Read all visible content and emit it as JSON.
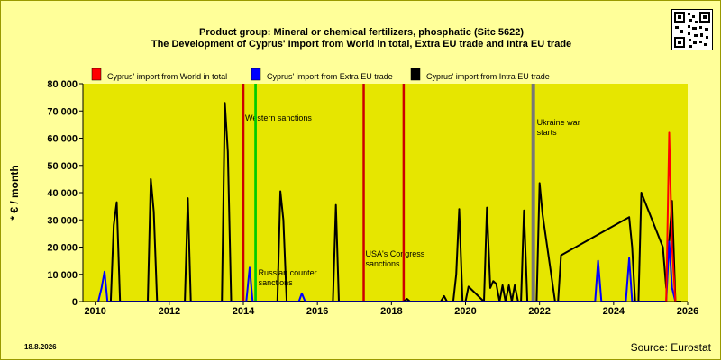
{
  "title_line1": "Product group: Mineral or chemical fertilizers, phosphatic (Sitc 5622)",
  "title_line2": "The Development of Cyprus' Import from World in total, Extra EU trade and Intra EU trade",
  "date_printed": "18.8.2026",
  "source": "Source: Eurostat",
  "icons": {
    "qr": "qr-code-icon"
  },
  "colors": {
    "background": "#ffff99",
    "plot_background": "#e6e600",
    "world": "#ff0000",
    "extra_eu": "#0000ff",
    "intra_eu": "#000000",
    "western_sanctions_line": "#00cc00",
    "event_line": "#cc0000",
    "ukraine_line": "#777777"
  },
  "chart_data": {
    "type": "line",
    "title": "Product group: Mineral or chemical fertilizers, phosphatic (Sitc 5622)",
    "subtitle": "The Development of Cyprus' Import from World in total, Extra EU trade and Intra EU trade",
    "xlabel": "",
    "ylabel": "* € / month",
    "xlim": [
      2009.667,
      2026.0
    ],
    "ylim": [
      0,
      80000
    ],
    "x_ticks": [
      2010,
      2012,
      2014,
      2016,
      2018,
      2020,
      2022,
      2024,
      2026
    ],
    "x_tick_labels": [
      "2010",
      "2012",
      "2014",
      "2016",
      "2018",
      "2020",
      "2022",
      "2024",
      "2026"
    ],
    "y_ticks": [
      0,
      10000,
      20000,
      30000,
      40000,
      50000,
      60000,
      70000,
      80000
    ],
    "y_tick_labels": [
      "0",
      "10 000",
      "20 000",
      "30 000",
      "40 000",
      "50 000",
      "60 000",
      "70 000",
      "80 000"
    ],
    "grid": false,
    "legend_position": "top",
    "series": [
      {
        "name": "Cyprus' import from World in total",
        "color": "#ff0000",
        "x": [
          2025.42,
          2025.5,
          2025.58,
          2025.67
        ],
        "y": [
          0,
          62000,
          20000,
          0
        ]
      },
      {
        "name": "Cyprus' import from Extra EU trade",
        "color": "#0000ff",
        "x": [
          2010.08,
          2010.17,
          2010.25,
          2010.33,
          2014.08,
          2014.17,
          2014.25,
          2015.5,
          2015.58,
          2015.67,
          2023.5,
          2023.58,
          2023.67,
          2024.33,
          2024.42,
          2024.5,
          2025.42,
          2025.5,
          2025.58,
          2025.67
        ],
        "y": [
          0,
          5000,
          11000,
          0,
          0,
          12500,
          0,
          0,
          3000,
          0,
          0,
          15000,
          0,
          0,
          16000,
          0,
          0,
          22000,
          5000,
          0
        ]
      },
      {
        "name": "Cyprus' import from Intra EU trade",
        "color": "#000000",
        "x": [
          2010.42,
          2010.5,
          2010.58,
          2010.67,
          2011.42,
          2011.5,
          2011.58,
          2011.67,
          2012.42,
          2012.5,
          2012.58,
          2013.42,
          2013.5,
          2013.58,
          2013.67,
          2014.92,
          2015.0,
          2015.08,
          2015.17,
          2016.42,
          2016.5,
          2016.58,
          2018.33,
          2018.42,
          2018.5,
          2019.33,
          2019.42,
          2019.5,
          2019.67,
          2019.75,
          2019.83,
          2019.92,
          2020.0,
          2020.08,
          2020.5,
          2020.58,
          2020.67,
          2020.75,
          2020.83,
          2020.92,
          2021.0,
          2021.08,
          2021.17,
          2021.25,
          2021.33,
          2021.42,
          2021.5,
          2021.58,
          2021.67,
          2021.92,
          2022.0,
          2022.08,
          2022.42,
          2022.5,
          2022.58,
          2024.42,
          2024.5,
          2024.58,
          2024.67,
          2024.75,
          2025.33,
          2025.42,
          2025.5,
          2025.58,
          2025.67,
          2025.75,
          2025.83
        ],
        "y": [
          0,
          28000,
          36500,
          0,
          0,
          45000,
          33000,
          0,
          0,
          38000,
          0,
          0,
          73000,
          55000,
          0,
          0,
          40500,
          30000,
          0,
          0,
          35500,
          0,
          0,
          1000,
          0,
          0,
          2000,
          0,
          0,
          10000,
          34000,
          0,
          0,
          5500,
          0,
          34500,
          5000,
          7500,
          6500,
          0,
          6000,
          0,
          6000,
          0,
          6000,
          0,
          0,
          33500,
          0,
          0,
          43500,
          32000,
          0,
          0,
          17000,
          31000,
          20000,
          0,
          0,
          40000,
          20000,
          5000,
          22000,
          37000,
          0,
          0,
          0
        ]
      }
    ],
    "annotations": [
      {
        "label": "Western sanctions",
        "x": 2014.0,
        "color": "#cc0000"
      },
      {
        "label": "",
        "x": 2014.33,
        "color": "#00cc00"
      },
      {
        "label": "Russian counter sanctions",
        "x": 2014.33,
        "color": "#00cc00"
      },
      {
        "label": "USA's Congress sanctions",
        "x": 2017.25,
        "color": "#cc0000"
      },
      {
        "label": "",
        "x": 2018.33,
        "color": "#cc0000"
      },
      {
        "label": "Ukraine war starts",
        "x": 2021.83,
        "color": "#777777"
      }
    ]
  }
}
